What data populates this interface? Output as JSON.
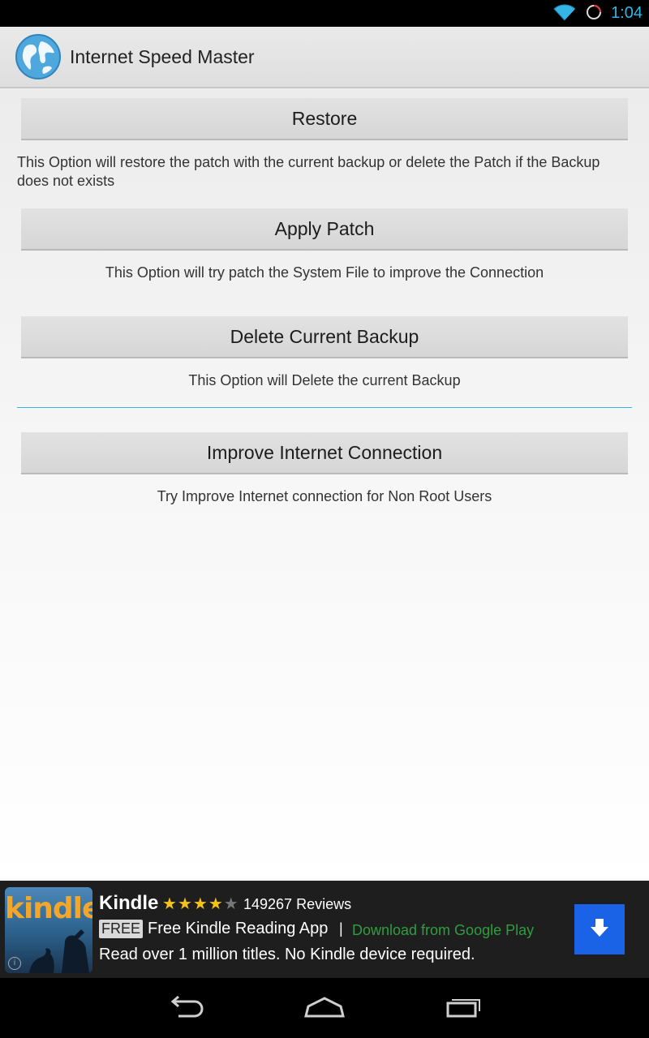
{
  "status_bar": {
    "time": "1:04"
  },
  "app_bar": {
    "title": "Internet Speed Master"
  },
  "options": [
    {
      "button": "Restore",
      "description": "This Option will restore the patch with the current backup or delete the Patch if the Backup does not exists"
    },
    {
      "button": "Apply Patch",
      "description": "This Option will try patch the System File to improve the Connection"
    },
    {
      "button": "Delete Current Backup",
      "description": "This Option will Delete the current Backup"
    },
    {
      "button": "Improve Internet Connection",
      "description": "Try Improve Internet connection for Non Root Users"
    }
  ],
  "ad": {
    "thumb_text": "kindle",
    "title": "Kindle",
    "rating": 4,
    "rating_max": 5,
    "reviews": "149267 Reviews",
    "free_badge": "FREE",
    "line2": "Free Kindle Reading App",
    "separator": "|",
    "link": "Download from Google Play",
    "line3": "Read over 1 million titles. No Kindle device required.",
    "info_icon": "i"
  },
  "colors": {
    "accent": "#33b5e5",
    "ad_link": "#2e9e3e",
    "download_button": "#1a62e6"
  }
}
